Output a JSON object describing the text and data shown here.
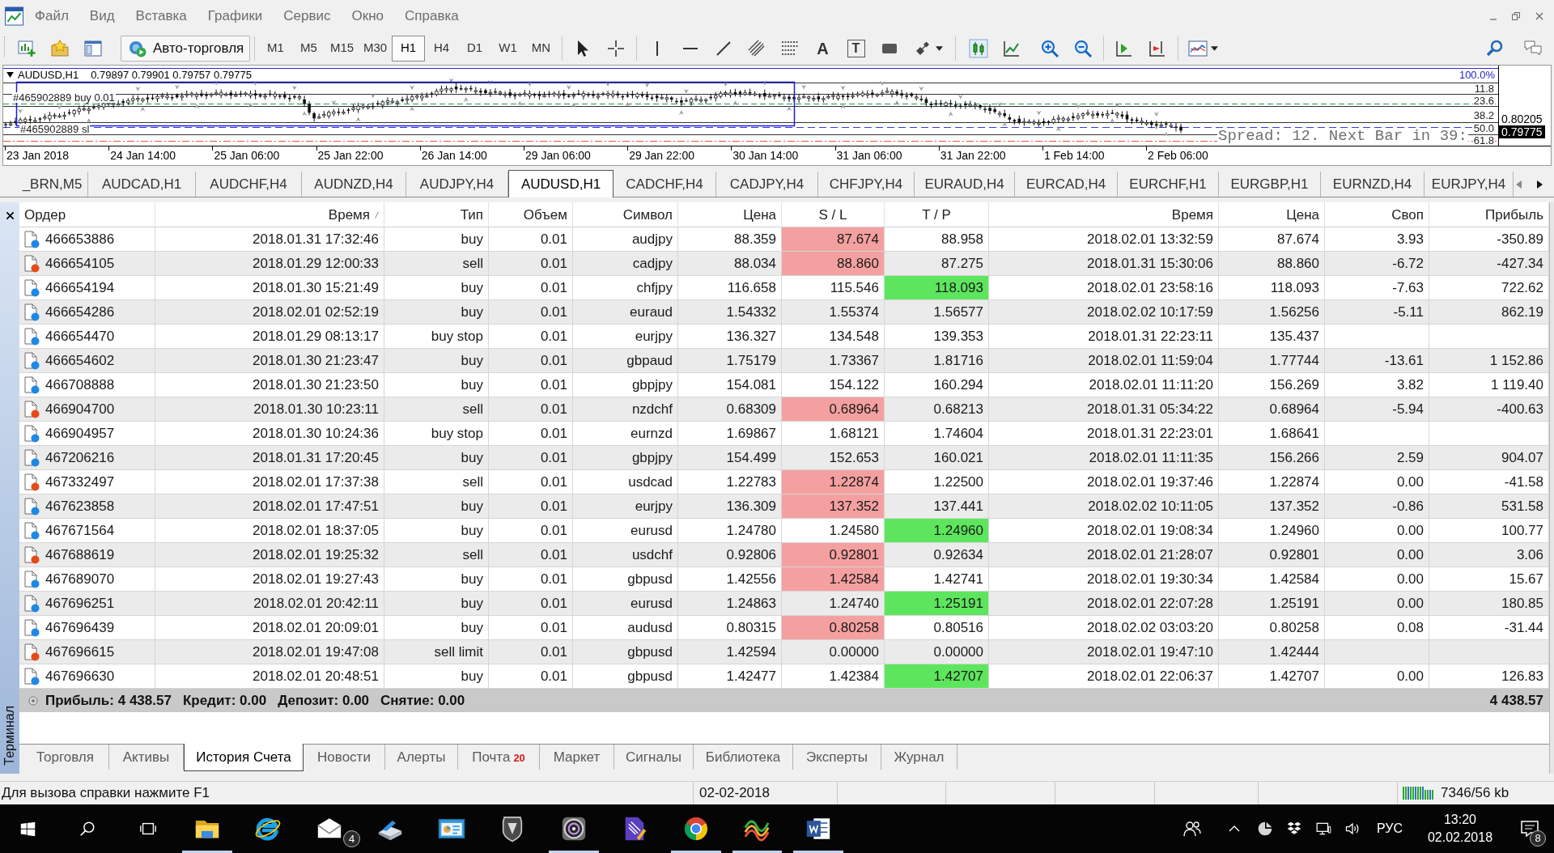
{
  "menu": [
    "Файл",
    "Вид",
    "Вставка",
    "Графики",
    "Сервис",
    "Окно",
    "Справка"
  ],
  "toolbar": {
    "autotrading": "Авто-торговля",
    "timeframes": [
      {
        "label": "M1",
        "selected": false
      },
      {
        "label": "M5",
        "selected": false
      },
      {
        "label": "M15",
        "selected": false
      },
      {
        "label": "M30",
        "selected": false
      },
      {
        "label": "H1",
        "selected": true
      },
      {
        "label": "H4",
        "selected": false
      },
      {
        "label": "D1",
        "selected": false
      },
      {
        "label": "W1",
        "selected": false
      },
      {
        "label": "MN",
        "selected": false
      }
    ],
    "text_tool": "A",
    "label_tool": "T"
  },
  "chart": {
    "symbol": "AUDUSD,H1",
    "ohlc": "0.79897 0.79901 0.79757 0.79775",
    "scale": "100.0%",
    "levels": [
      "11.8",
      "23.6",
      "38.2",
      "50.0",
      "61.8"
    ],
    "orders": [
      "#465902889 buy 0.01",
      "#465902889 sl"
    ],
    "info": "Spread: 12. Next Bar in 39:",
    "prices": [
      {
        "text": "0.80205",
        "current": false
      },
      {
        "text": "0.79775",
        "current": true
      }
    ],
    "time_labels": [
      "23 Jan 2018",
      "24 Jan 14:00",
      "25 Jan 06:00",
      "25 Jan 22:00",
      "26 Jan 14:00",
      "29 Jan 06:00",
      "29 Jan 22:00",
      "30 Jan 14:00",
      "31 Jan 06:00",
      "31 Jan 22:00",
      "1 Feb 14:00",
      "2 Feb 06:00"
    ]
  },
  "symbol_tabs": [
    {
      "label": "_BRN,M5",
      "selected": false
    },
    {
      "label": "AUDCAD,H1",
      "selected": false
    },
    {
      "label": "AUDCHF,H4",
      "selected": false
    },
    {
      "label": "AUDNZD,H4",
      "selected": false
    },
    {
      "label": "AUDJPY,H4",
      "selected": false
    },
    {
      "label": "AUDUSD,H1",
      "selected": true
    },
    {
      "label": "CADCHF,H4",
      "selected": false
    },
    {
      "label": "CADJPY,H4",
      "selected": false
    },
    {
      "label": "CHFJPY,H4",
      "selected": false
    },
    {
      "label": "EURAUD,H4",
      "selected": false
    },
    {
      "label": "EURCAD,H4",
      "selected": false
    },
    {
      "label": "EURCHF,H1",
      "selected": false
    },
    {
      "label": "EURGBP,H1",
      "selected": false
    },
    {
      "label": "EURNZD,H4",
      "selected": false
    },
    {
      "label": "EURJPY,H4",
      "selected": false
    }
  ],
  "terminal": {
    "title": "Терминал"
  },
  "table": {
    "columns": [
      {
        "label": "Ордер",
        "sorted": false
      },
      {
        "label": "Время",
        "sorted": true
      },
      {
        "label": "Тип",
        "sorted": false
      },
      {
        "label": "Объем",
        "sorted": false
      },
      {
        "label": "Символ",
        "sorted": false
      },
      {
        "label": "Цена",
        "sorted": false
      },
      {
        "label": "S / L",
        "sorted": false
      },
      {
        "label": "T / P",
        "sorted": false
      },
      {
        "label": "Время",
        "sorted": false
      },
      {
        "label": "Цена",
        "sorted": false
      },
      {
        "label": "Своп",
        "sorted": false
      },
      {
        "label": "Прибыль",
        "sorted": false
      }
    ],
    "rows": [
      {
        "order": "466653886",
        "color": "#1e88e5",
        "open_time": "2018.01.31 17:32:46",
        "type": "buy",
        "volume": "0.01",
        "symbol": "audjpy",
        "open_price": "88.359",
        "sl": "87.674",
        "sl_hit": true,
        "tp": "88.958",
        "tp_hit": false,
        "close_time": "2018.02.01 13:32:59",
        "close_price": "87.674",
        "swap": "3.93",
        "profit": "-350.89"
      },
      {
        "order": "466654105",
        "color": "#e64a19",
        "open_time": "2018.01.29 12:00:33",
        "type": "sell",
        "volume": "0.01",
        "symbol": "cadjpy",
        "open_price": "88.034",
        "sl": "88.860",
        "sl_hit": true,
        "tp": "87.275",
        "tp_hit": false,
        "close_time": "2018.01.31 15:30:06",
        "close_price": "88.860",
        "swap": "-6.72",
        "profit": "-427.34"
      },
      {
        "order": "466654194",
        "color": "#1e88e5",
        "open_time": "2018.01.30 15:21:49",
        "type": "buy",
        "volume": "0.01",
        "symbol": "chfjpy",
        "open_price": "116.658",
        "sl": "115.546",
        "sl_hit": false,
        "tp": "118.093",
        "tp_hit": true,
        "close_time": "2018.02.01 23:58:16",
        "close_price": "118.093",
        "swap": "-7.63",
        "profit": "722.62"
      },
      {
        "order": "466654286",
        "color": "#1e88e5",
        "open_time": "2018.02.01 02:52:19",
        "type": "buy",
        "volume": "0.01",
        "symbol": "euraud",
        "open_price": "1.54332",
        "sl": "1.55374",
        "sl_hit": false,
        "tp": "1.56577",
        "tp_hit": false,
        "close_time": "2018.02.02 10:17:59",
        "close_price": "1.56256",
        "swap": "-5.11",
        "profit": "862.19"
      },
      {
        "order": "466654470",
        "color": "#1e88e5",
        "open_time": "2018.01.29 08:13:17",
        "type": "buy stop",
        "volume": "0.01",
        "symbol": "eurjpy",
        "open_price": "136.327",
        "sl": "134.548",
        "sl_hit": false,
        "tp": "139.353",
        "tp_hit": false,
        "close_time": "2018.01.31 22:23:11",
        "close_price": "135.437"
      },
      {
        "order": "466654602",
        "color": "#1e88e5",
        "open_time": "2018.01.30 21:23:47",
        "type": "buy",
        "volume": "0.01",
        "symbol": "gbpaud",
        "open_price": "1.75179",
        "sl": "1.73367",
        "sl_hit": false,
        "tp": "1.81716",
        "tp_hit": false,
        "close_time": "2018.02.01 11:59:04",
        "close_price": "1.77744",
        "swap": "-13.61",
        "profit": "1 152.86"
      },
      {
        "order": "466708888",
        "color": "#1e88e5",
        "open_time": "2018.01.30 21:23:50",
        "type": "buy",
        "volume": "0.01",
        "symbol": "gbpjpy",
        "open_price": "154.081",
        "sl": "154.122",
        "sl_hit": false,
        "tp": "160.294",
        "tp_hit": false,
        "close_time": "2018.02.01 11:11:20",
        "close_price": "156.269",
        "swap": "3.82",
        "profit": "1 119.40"
      },
      {
        "order": "466904700",
        "color": "#e64a19",
        "open_time": "2018.01.30 10:23:11",
        "type": "sell",
        "volume": "0.01",
        "symbol": "nzdchf",
        "open_price": "0.68309",
        "sl": "0.68964",
        "sl_hit": true,
        "tp": "0.68213",
        "tp_hit": false,
        "close_time": "2018.01.31 05:34:22",
        "close_price": "0.68964",
        "swap": "-5.94",
        "profit": "-400.63"
      },
      {
        "order": "466904957",
        "color": "#1e88e5",
        "open_time": "2018.01.30 10:24:36",
        "type": "buy stop",
        "volume": "0.01",
        "symbol": "eurnzd",
        "open_price": "1.69867",
        "sl": "1.68121",
        "sl_hit": false,
        "tp": "1.74604",
        "tp_hit": false,
        "close_time": "2018.01.31 22:23:01",
        "close_price": "1.68641"
      },
      {
        "order": "467206216",
        "color": "#1e88e5",
        "open_time": "2018.01.31 17:20:45",
        "type": "buy",
        "volume": "0.01",
        "symbol": "gbpjpy",
        "open_price": "154.499",
        "sl": "152.653",
        "sl_hit": false,
        "tp": "160.021",
        "tp_hit": false,
        "close_time": "2018.02.01 11:11:35",
        "close_price": "156.266",
        "swap": "2.59",
        "profit": "904.07"
      },
      {
        "order": "467332497",
        "color": "#e64a19",
        "open_time": "2018.02.01 17:37:38",
        "type": "sell",
        "volume": "0.01",
        "symbol": "usdcad",
        "open_price": "1.22783",
        "sl": "1.22874",
        "sl_hit": true,
        "tp": "1.22500",
        "tp_hit": false,
        "close_time": "2018.02.01 19:37:46",
        "close_price": "1.22874",
        "swap": "0.00",
        "profit": "-41.58"
      },
      {
        "order": "467623858",
        "color": "#1e88e5",
        "open_time": "2018.02.01 17:47:51",
        "type": "buy",
        "volume": "0.01",
        "symbol": "eurjpy",
        "open_price": "136.309",
        "sl": "137.352",
        "sl_hit": true,
        "tp": "137.441",
        "tp_hit": false,
        "close_time": "2018.02.02 10:11:05",
        "close_price": "137.352",
        "swap": "-0.86",
        "profit": "531.58"
      },
      {
        "order": "467671564",
        "color": "#1e88e5",
        "open_time": "2018.02.01 18:37:05",
        "type": "buy",
        "volume": "0.01",
        "symbol": "eurusd",
        "open_price": "1.24780",
        "sl": "1.24580",
        "sl_hit": false,
        "tp": "1.24960",
        "tp_hit": true,
        "close_time": "2018.02.01 19:08:34",
        "close_price": "1.24960",
        "swap": "0.00",
        "profit": "100.77"
      },
      {
        "order": "467688619",
        "color": "#e64a19",
        "open_time": "2018.02.01 19:25:32",
        "type": "sell",
        "volume": "0.01",
        "symbol": "usdchf",
        "open_price": "0.92806",
        "sl": "0.92801",
        "sl_hit": true,
        "tp": "0.92634",
        "tp_hit": false,
        "close_time": "2018.02.01 21:28:07",
        "close_price": "0.92801",
        "swap": "0.00",
        "profit": "3.06"
      },
      {
        "order": "467689070",
        "color": "#1e88e5",
        "open_time": "2018.02.01 19:27:43",
        "type": "buy",
        "volume": "0.01",
        "symbol": "gbpusd",
        "open_price": "1.42556",
        "sl": "1.42584",
        "sl_hit": true,
        "tp": "1.42741",
        "tp_hit": false,
        "close_time": "2018.02.01 19:30:34",
        "close_price": "1.42584",
        "swap": "0.00",
        "profit": "15.67"
      },
      {
        "order": "467696251",
        "color": "#1e88e5",
        "open_time": "2018.02.01 20:42:11",
        "type": "buy",
        "volume": "0.01",
        "symbol": "eurusd",
        "open_price": "1.24863",
        "sl": "1.24740",
        "sl_hit": false,
        "tp": "1.25191",
        "tp_hit": true,
        "close_time": "2018.02.01 22:07:28",
        "close_price": "1.25191",
        "swap": "0.00",
        "profit": "180.85"
      },
      {
        "order": "467696439",
        "color": "#1e88e5",
        "open_time": "2018.02.01 20:09:01",
        "type": "buy",
        "volume": "0.01",
        "symbol": "audusd",
        "open_price": "0.80315",
        "sl": "0.80258",
        "sl_hit": true,
        "tp": "0.80516",
        "tp_hit": false,
        "close_time": "2018.02.02 03:03:20",
        "close_price": "0.80258",
        "swap": "0.08",
        "profit": "-31.44"
      },
      {
        "order": "467696615",
        "color": "#e64a19",
        "open_time": "2018.02.01 19:47:08",
        "type": "sell limit",
        "volume": "0.01",
        "symbol": "gbpusd",
        "open_price": "1.42594",
        "sl": "0.00000",
        "sl_hit": false,
        "tp": "0.00000",
        "tp_hit": false,
        "close_time": "2018.02.01 19:47:10",
        "close_price": "1.42444"
      },
      {
        "order": "467696630",
        "color": "#1e88e5",
        "open_time": "2018.02.01 20:48:51",
        "type": "buy",
        "volume": "0.01",
        "symbol": "gbpusd",
        "open_price": "1.42477",
        "sl": "1.42384",
        "sl_hit": false,
        "tp": "1.42707",
        "tp_hit": true,
        "close_time": "2018.02.01 22:06:37",
        "close_price": "1.42707",
        "swap": "0.00",
        "profit": "126.83"
      }
    ],
    "summary": {
      "items": [
        "Прибыль: 4 438.57",
        "Кредит: 0.00",
        "Депозит: 0.00",
        "Снятие: 0.00"
      ],
      "total": "4 438.57"
    }
  },
  "bottom_tabs": [
    {
      "label": "Торговля",
      "selected": false
    },
    {
      "label": "Активы",
      "selected": false
    },
    {
      "label": "История Счета",
      "selected": true
    },
    {
      "label": "Новости",
      "selected": false
    },
    {
      "label": "Алерты",
      "selected": false
    },
    {
      "label": "Почта",
      "badge": "20",
      "selected": false
    },
    {
      "label": "Маркет",
      "selected": false
    },
    {
      "label": "Сигналы",
      "selected": false
    },
    {
      "label": "Библиотека",
      "selected": false
    },
    {
      "label": "Эксперты",
      "selected": false
    },
    {
      "label": "Журнал",
      "selected": false
    }
  ],
  "status_bar": {
    "help": "Для вызова справки нажмите F1",
    "date": "02-02-2018",
    "traffic": "7346/56 kb"
  },
  "taskbar": {
    "apps": [
      {
        "kind": "folder",
        "running": true
      },
      {
        "kind": "ie",
        "running": false
      },
      {
        "kind": "mail",
        "badge": "4",
        "running": false
      },
      {
        "kind": "scanner",
        "running": false
      },
      {
        "kind": "dashboard",
        "running": false
      },
      {
        "kind": "shield",
        "running": false
      },
      {
        "kind": "lens",
        "running": true
      },
      {
        "kind": "docpen",
        "running": false
      },
      {
        "kind": "chrome",
        "running": true
      },
      {
        "kind": "waves",
        "running": true
      },
      {
        "kind": "word",
        "running": true
      }
    ],
    "language": "РУС",
    "time": "13:20",
    "date": "02.02.2018",
    "notifications": "8"
  }
}
